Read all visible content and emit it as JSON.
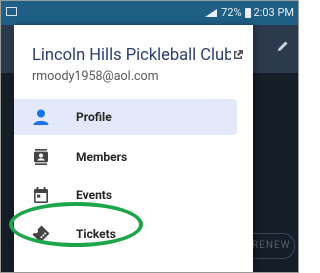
{
  "status_bar": {
    "battery": "72%",
    "time": "2:03 PM"
  },
  "drawer": {
    "club_name": "Lincoln Hills Pickleball Club",
    "email": "rmoody1958@aol.com",
    "items": [
      {
        "label": "Profile",
        "icon": "person-icon",
        "active": true
      },
      {
        "label": "Members",
        "icon": "contact-card-icon",
        "active": false
      },
      {
        "label": "Events",
        "icon": "calendar-icon",
        "active": false
      },
      {
        "label": "Tickets",
        "icon": "ticket-icon",
        "active": false
      }
    ]
  },
  "background": {
    "renew_label": "RENEW"
  },
  "colors": {
    "accent": "#1a73e8",
    "highlight": "#1ca64b",
    "status_bar": "#1f5f86"
  }
}
